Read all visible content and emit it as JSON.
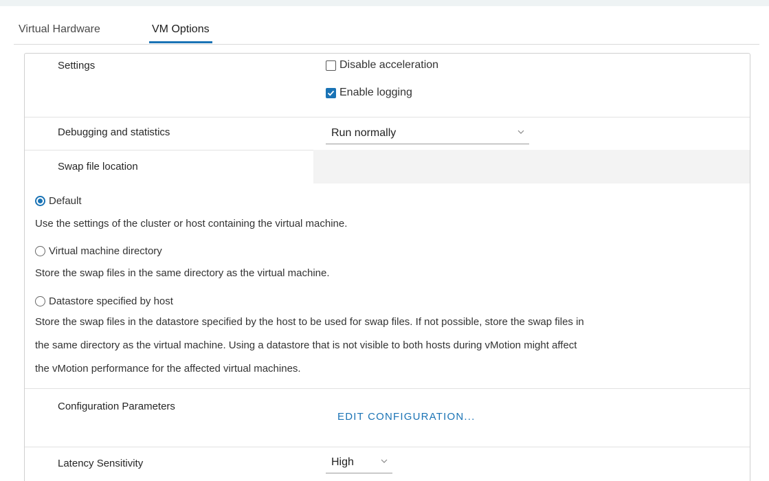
{
  "tabs": [
    {
      "label": "Virtual Hardware",
      "active": false
    },
    {
      "label": "VM Options",
      "active": true
    }
  ],
  "settings": {
    "label": "Settings",
    "options": [
      {
        "label": "Disable acceleration",
        "checked": false
      },
      {
        "label": "Enable logging",
        "checked": true
      }
    ]
  },
  "debugging": {
    "label": "Debugging and statistics",
    "value": "Run normally"
  },
  "swap": {
    "label": "Swap file location",
    "options": [
      {
        "label": "Default",
        "checked": true,
        "description": "Use the settings of the cluster or host containing the virtual machine."
      },
      {
        "label": "Virtual machine directory",
        "checked": false,
        "description": "Store the swap files in the same directory as the virtual machine."
      },
      {
        "label": "Datastore specified by host",
        "checked": false,
        "description_lines": [
          "Store the swap files in the datastore specified by the host to be used for swap files. If not possible, store the swap files in",
          "the same directory as the virtual machine. Using a datastore that is not visible to both hosts during vMotion might affect",
          "the vMotion performance for the affected virtual machines."
        ]
      }
    ]
  },
  "config": {
    "label": "Configuration Parameters",
    "button": "EDIT CONFIGURATION..."
  },
  "latency": {
    "label": "Latency Sensitivity",
    "value": "High"
  },
  "colors": {
    "accent": "#1a73b5"
  }
}
